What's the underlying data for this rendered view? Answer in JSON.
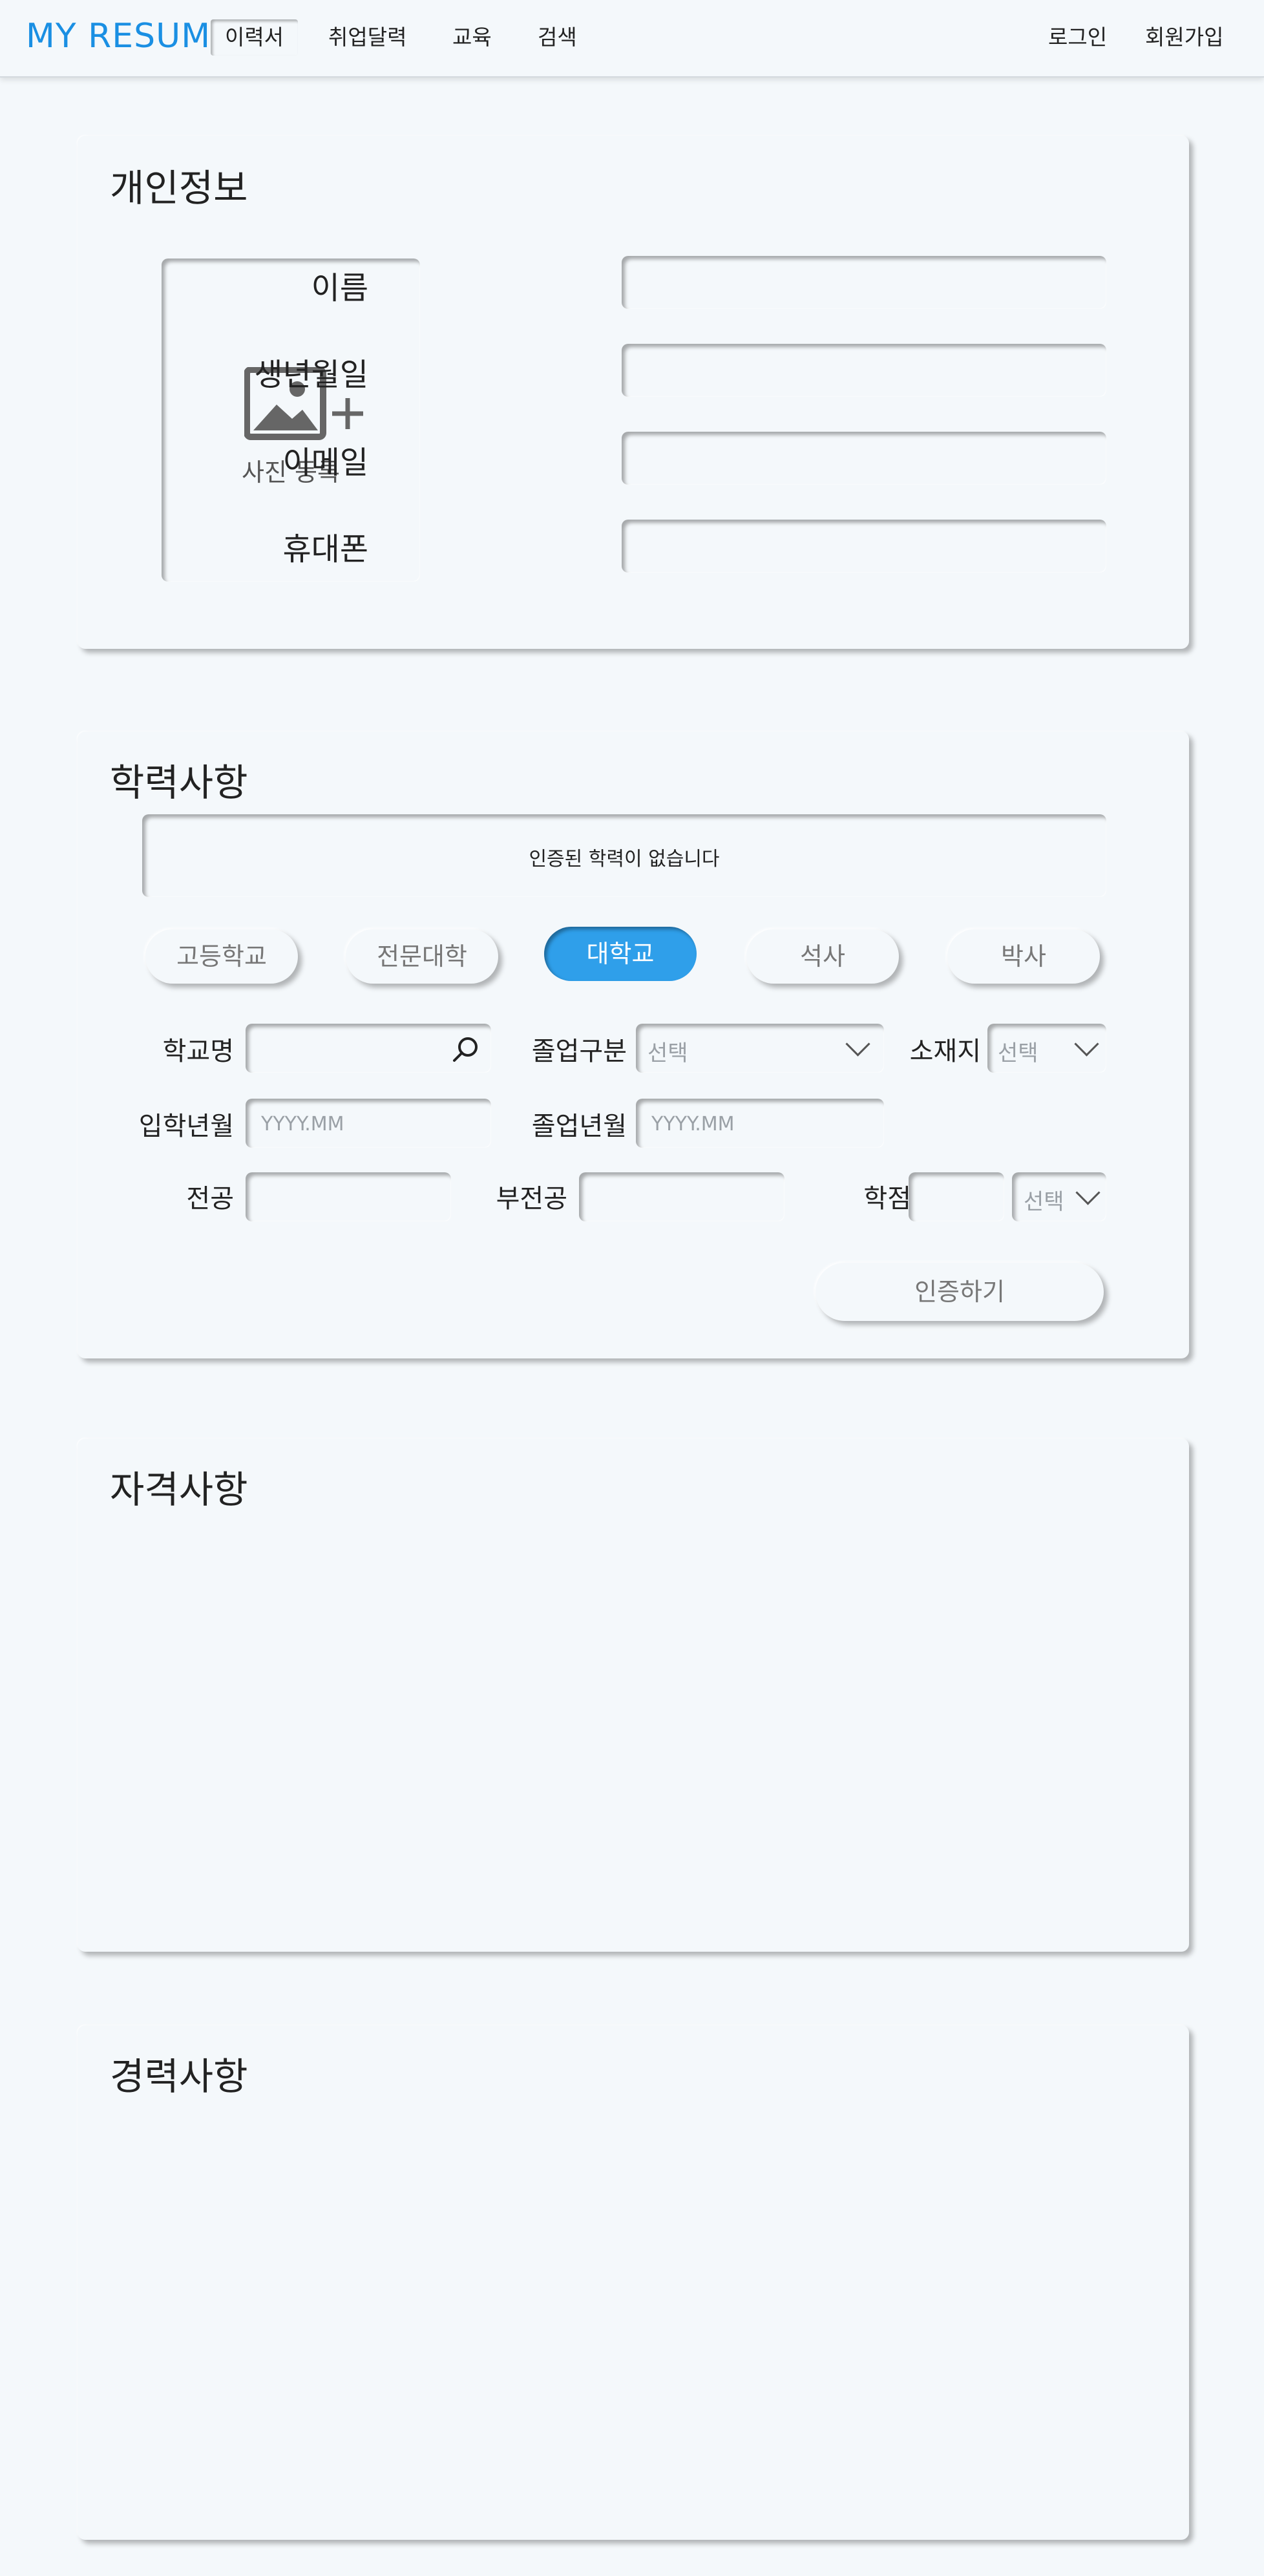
{
  "brand": "MY RESUM",
  "nav": {
    "tabs": [
      "이력서",
      "취업달력",
      "교육",
      "검색"
    ],
    "login": "로그인",
    "signup": "회원가입"
  },
  "personal": {
    "title": "개인정보",
    "photo_label": "사진 등록",
    "fields": [
      "이름",
      "생년월일",
      "이메일",
      "휴대폰"
    ]
  },
  "education": {
    "title": "학력사항",
    "notice": "인증된 학력이 없습니다",
    "levels": [
      "고등학교",
      "전문대학",
      "대학교",
      "석사",
      "박사"
    ],
    "active_level": "대학교",
    "school_label": "학교명",
    "grad_type_label": "졸업구분",
    "grad_type_value": "선택",
    "location_label": "소재지",
    "location_value": "선택",
    "entry_label": "입학년월",
    "entry_placeholder": "YYYY.MM",
    "grad_label": "졸업년월",
    "grad_placeholder": "YYYY.MM",
    "major_label": "전공",
    "minor_label": "부전공",
    "gpa_label": "학점",
    "gpa_scale_value": "선택",
    "verify_button": "인증하기"
  },
  "certs": {
    "title": "자격사항"
  },
  "career": {
    "title": "경력사항"
  },
  "colors": {
    "accent": "#2f9fea",
    "brand": "#1a8fe3",
    "background": "#f4f8fb"
  }
}
